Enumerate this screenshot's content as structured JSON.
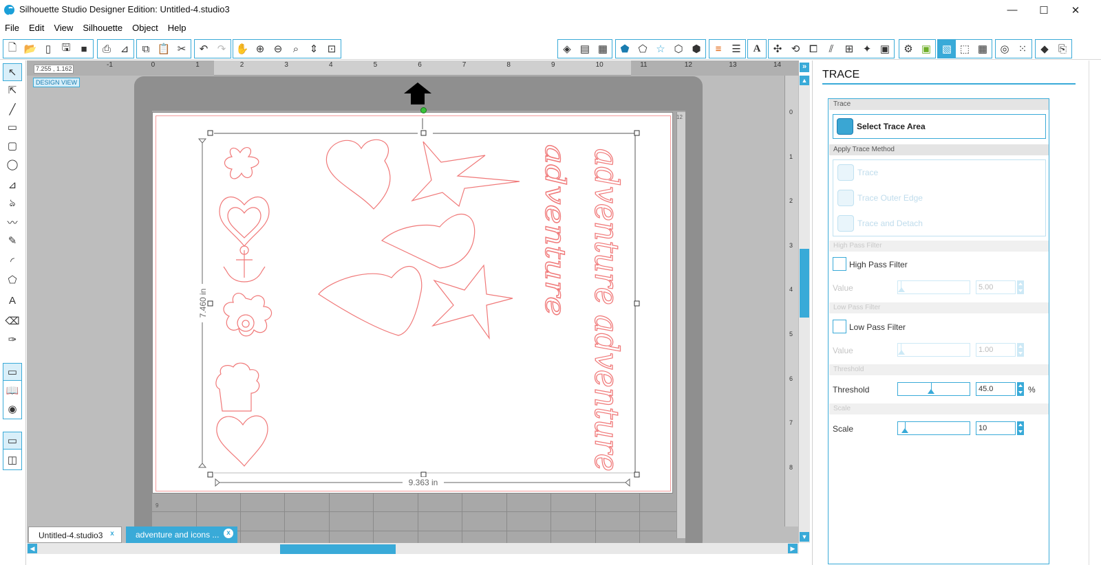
{
  "window": {
    "title": "Silhouette Studio Designer Edition: Untitled-4.studio3",
    "minimize": "—",
    "maximize": "☐",
    "close": "✕"
  },
  "menu": [
    "File",
    "Edit",
    "View",
    "Silhouette",
    "Object",
    "Help"
  ],
  "canvas": {
    "coords": "7.255 , 1.162",
    "design_view_label": "DESIGN VIEW",
    "ruler_numbers": [
      "-1",
      "0",
      "1",
      "2",
      "3",
      "4",
      "5",
      "6",
      "7",
      "8",
      "9",
      "10",
      "11",
      "12",
      "13",
      "14"
    ],
    "vertical_ruler_numbers": [
      "0",
      "1",
      "2",
      "3",
      "4",
      "5",
      "6",
      "7",
      "8"
    ],
    "mat_corner_top": "12",
    "mat_corner_bottom": "9",
    "height_dimension": "7.460 in",
    "width_dimension": "9.363 in",
    "script_text_1": "adventure adventure",
    "script_text_2": "adventure"
  },
  "tabs": [
    {
      "label": "Untitled-4.studio3",
      "close": "x"
    },
    {
      "label": "adventure and icons ...",
      "close": "x"
    }
  ],
  "panel": {
    "title": "TRACE",
    "sections": {
      "trace": "Trace",
      "apply": "Apply Trace Method",
      "high_pass": "High Pass Filter",
      "low_pass": "Low Pass Filter",
      "threshold": "Threshold",
      "scale": "Scale"
    },
    "select_trace_area": "Select Trace Area",
    "methods": [
      "Trace",
      "Trace Outer Edge",
      "Trace and Detach"
    ],
    "high_pass_label": "High Pass Filter",
    "high_pass_value_label": "Value",
    "high_pass_value": "5.00",
    "low_pass_label": "Low Pass Filter",
    "low_pass_value_label": "Value",
    "low_pass_value": "1.00",
    "threshold_label": "Threshold",
    "threshold_value": "45.0",
    "threshold_unit": "%",
    "scale_label": "Scale",
    "scale_value": "10"
  },
  "colors": {
    "accent": "#39aad8",
    "cut_line": "#f07878",
    "mat": "#8f8f8f"
  }
}
